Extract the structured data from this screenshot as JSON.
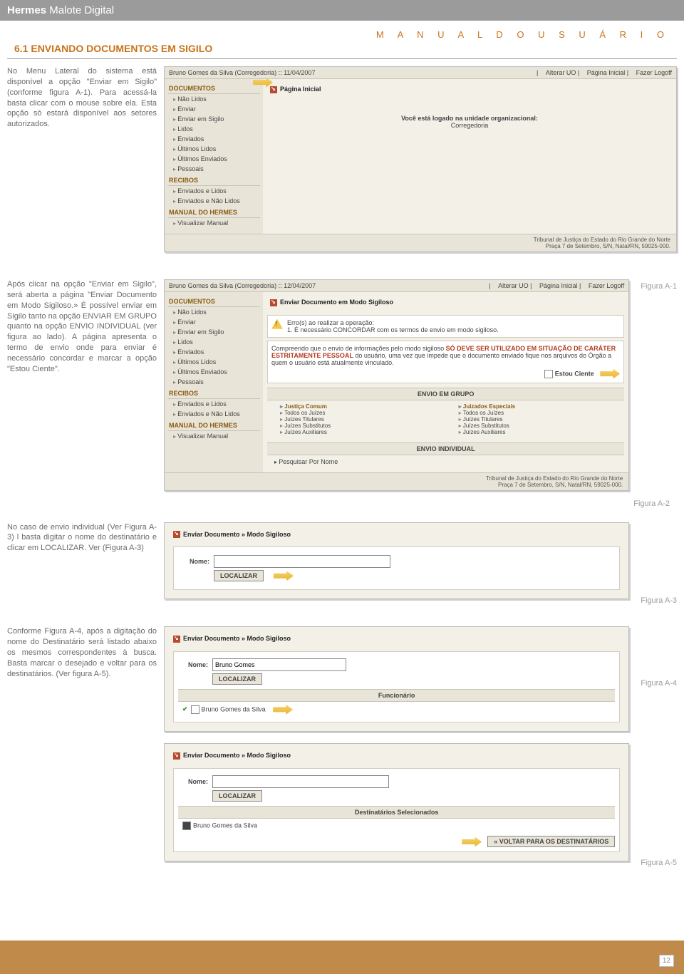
{
  "header": {
    "brand_a": "Hermes",
    "brand_b": " Malote Digital"
  },
  "manual": "M A N U A L   D O   U S U Á R I O",
  "section_title": "6.1 ENVIANDO DOCUMENTOS EM SIGILO",
  "para1": "No Menu Lateral do sistema está disponível a opção \"Enviar em Sigilo\" (conforme figura A-1). Para acessá-la basta clicar com o mouse sobre ela. Esta opção só estará disponível aos setores autorizados.",
  "para2": "Após clicar na opção \"Enviar em Sigilo\", será aberta a página \"Enviar Documento em Modo Sigiloso.» É possível enviar em Sigilo tanto na opção ENVIAR EM GRUPO quanto na opção ENVIO INDIVIDUAL (ver figura ao lado). A página apresenta o termo de envio onde para enviar  é necessário concordar e marcar a opção \"Estou Ciente\".",
  "para3": "No caso de envio individual (Ver Figura A-3) l basta digitar o nome do destinatário e clicar em LOCALIZAR. Ver (Figura A-3)",
  "para4": "Conforme Figura A-4, após a digitação do nome do Destinatário será listado abaixo os mesmos correspondentes à busca. Basta marcar o desejado e voltar para os destinatários. (Ver figura A-5).",
  "fig_a1": "Figura A-1",
  "fig_a2": "Figura A-2",
  "fig_a3": "Figura A-3",
  "fig_a4": "Figura A-4",
  "fig_a5": "Figura A-5",
  "page_number": "12",
  "shot1": {
    "user": "Bruno Gomes da Silva (Corregedoria) :: 11/04/2007",
    "links": {
      "a": "Alterar UO",
      "b": "Página Inicial",
      "c": "Fazer Logoff"
    },
    "title": "Página Inicial",
    "logged": "Você está logado na unidade organizacional:",
    "unit": "Corregedoria",
    "sb": {
      "h1": "DOCUMENTOS",
      "i1": "Não Lidos",
      "i2": "Enviar",
      "i3": "Enviar em Sigilo",
      "i4": "Lidos",
      "i5": "Enviados",
      "i6": "Últimos Lidos",
      "i7": "Últimos Enviados",
      "i8": "Pessoais",
      "h2": "RECIBOS",
      "i9": "Enviados e Lidos",
      "i10": "Enviados e Não Lidos",
      "h3": "MANUAL DO HERMES",
      "i11": "Visualizar Manual"
    },
    "foot1": "Tribunal de Justiça do Estado do Rio Grande do Norte",
    "foot2": "Praça 7 de Setembro, S/N, Natal/RN, 59025-000."
  },
  "shot2": {
    "user": "Bruno Gomes da Silva (Corregedoria) :: 12/04/2007",
    "title": "Enviar Documento em Modo Sigiloso",
    "err1": "Erro(s) ao realizar a operação:",
    "err2": "1. É necessário CONCORDAR com os termos de envio em modo sigiloso.",
    "term1": "Compreendo que o envio de informações pelo modo sigiloso ",
    "term_red": "SÓ DEVE SER UTILIZADO EM SITUAÇÃO DE CARÁTER ESTRITAMENTE PESSOAL",
    "term2": " do usuário, uma vez que impede que o documento enviado fique nos arquivos do Órgão a quem o usuário está atualmente vinculado.",
    "ciente": "Estou Ciente",
    "grp_head": "ENVIO EM GRUPO",
    "col_a": "Justiça Comum",
    "col_b": "Juizados Especiais",
    "g1": "Todos os Juízes",
    "g2": "Juízes Titulares",
    "g3": "Juízes Substitutos",
    "g4": "Juízes Auxiliares",
    "indiv": "ENVIO INDIVIDUAL",
    "pesq": "Pesquisar Por Nome"
  },
  "shot3": {
    "title": "Enviar Documento » Modo Sigiloso",
    "nome_lbl": "Nome:",
    "btn": "LOCALIZAR"
  },
  "shot4": {
    "title": "Enviar Documento » Modo Sigiloso",
    "nome_lbl": "Nome:",
    "nome_val": "Bruno Gomes",
    "btn": "LOCALIZAR",
    "func": "Funcionário",
    "row": "Bruno Gomes da Silva"
  },
  "shot5": {
    "title": "Enviar Documento » Modo Sigiloso",
    "nome_lbl": "Nome:",
    "btn": "LOCALIZAR",
    "dest": "Destinatários Selecionados",
    "row": "Bruno Gomes da Silva",
    "back": "« VOLTAR PARA OS DESTINATÁRIOS"
  }
}
